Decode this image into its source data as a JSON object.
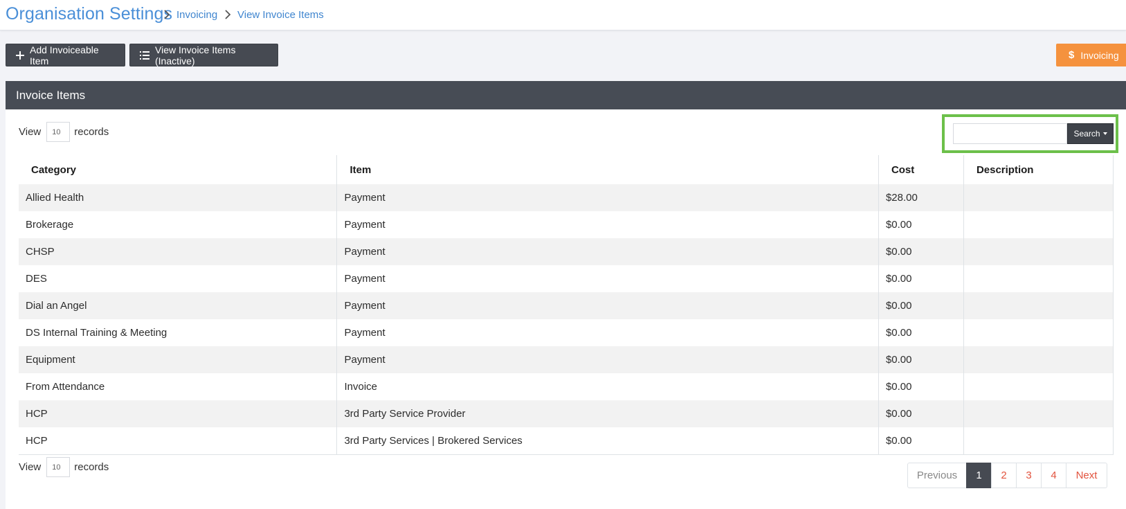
{
  "header": {
    "title": "Organisation Settings",
    "breadcrumb": [
      {
        "label": "Invoicing"
      },
      {
        "label": "View Invoice Items"
      }
    ]
  },
  "toolbar": {
    "add_label": "Add Invoiceable Item",
    "inactive_label": "View Invoice Items (Inactive)",
    "invoicing_label": "Invoicing",
    "invoicing_color": "#f5923e"
  },
  "panel": {
    "title": "Invoice Items",
    "view_label": "View",
    "records_label": "records",
    "page_size": "10"
  },
  "search": {
    "value": "",
    "button_label": "Search",
    "highlight_color": "#6cc04a"
  },
  "table": {
    "columns": [
      "Category",
      "Item",
      "Cost",
      "Description"
    ],
    "rows": [
      {
        "category": "Allied Health",
        "item": "Payment",
        "cost": "$28.00",
        "description": ""
      },
      {
        "category": "Brokerage",
        "item": "Payment",
        "cost": "$0.00",
        "description": ""
      },
      {
        "category": "CHSP",
        "item": "Payment",
        "cost": "$0.00",
        "description": ""
      },
      {
        "category": "DES",
        "item": "Payment",
        "cost": "$0.00",
        "description": ""
      },
      {
        "category": "Dial an Angel",
        "item": "Payment",
        "cost": "$0.00",
        "description": ""
      },
      {
        "category": "DS Internal Training & Meeting",
        "item": "Payment",
        "cost": "$0.00",
        "description": ""
      },
      {
        "category": "Equipment",
        "item": "Payment",
        "cost": "$0.00",
        "description": ""
      },
      {
        "category": "From Attendance",
        "item": "Invoice",
        "cost": "$0.00",
        "description": ""
      },
      {
        "category": "HCP",
        "item": "3rd Party Service Provider",
        "cost": "$0.00",
        "description": ""
      },
      {
        "category": "HCP",
        "item": "3rd Party Services | Brokered Services",
        "cost": "$0.00",
        "description": ""
      }
    ]
  },
  "pagination": {
    "previous_label": "Previous",
    "pages": [
      "1",
      "2",
      "3",
      "4"
    ],
    "current": "1",
    "next_label": "Next"
  }
}
